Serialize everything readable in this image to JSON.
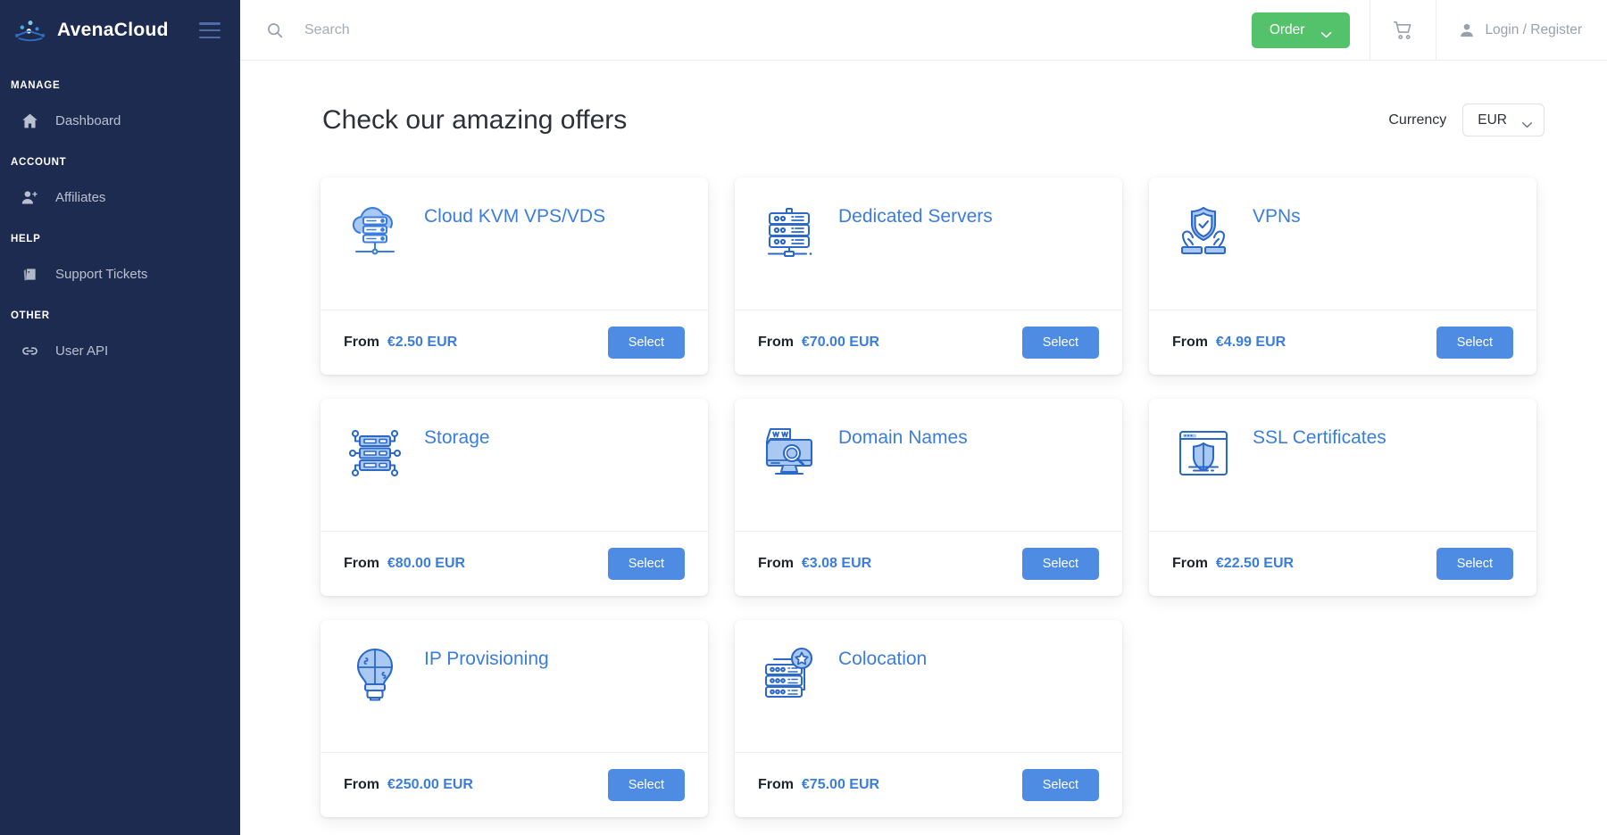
{
  "sidebar": {
    "brand": "AvenaCloud",
    "logo_icon": "avenacloud-logo-icon",
    "menu_toggle_icon": "hamburger-icon",
    "sections": [
      {
        "caption": "MANAGE",
        "items": [
          {
            "label": "Dashboard",
            "icon": "home-icon"
          }
        ]
      },
      {
        "caption": "ACCOUNT",
        "items": [
          {
            "label": "Affiliates",
            "icon": "user-add-icon"
          }
        ]
      },
      {
        "caption": "HELP",
        "items": [
          {
            "label": "Support Tickets",
            "icon": "tickets-icon"
          }
        ]
      },
      {
        "caption": "OTHER",
        "items": [
          {
            "label": "User API",
            "icon": "link-icon"
          }
        ]
      }
    ]
  },
  "topbar": {
    "search_icon": "search-icon",
    "search_value": "",
    "search_placeholder": "Search",
    "order_label": "Order",
    "order_chevron_icon": "chevron-down-icon",
    "cart_icon": "shopping-cart-icon",
    "account_icon": "person-icon",
    "account_label": "Login / Register"
  },
  "page": {
    "title": "Check our amazing offers",
    "currency_label": "Currency",
    "currency_value": "EUR",
    "currency_chevron_icon": "chevron-down-icon"
  },
  "colors": {
    "sidebar_bg": "#1e2b50",
    "accent_blue": "#3b7ddd",
    "select_button": "#4e8ce4",
    "order_button": "#53c26a",
    "title_text": "#2c3138",
    "muted_text": "#9aa0ac"
  },
  "products": [
    {
      "title": "Cloud KVM VPS/VDS",
      "icon": "cloud-server-icon",
      "price_prefix": "From",
      "price": "€2.50 EUR",
      "button": "Select"
    },
    {
      "title": "Dedicated Servers",
      "icon": "server-rack-icon",
      "price_prefix": "From",
      "price": "€70.00 EUR",
      "button": "Select"
    },
    {
      "title": "VPNs",
      "icon": "shield-hands-icon",
      "price_prefix": "From",
      "price": "€4.99 EUR",
      "button": "Select"
    },
    {
      "title": "Storage",
      "icon": "storage-nodes-icon",
      "price_prefix": "From",
      "price": "€80.00 EUR",
      "button": "Select"
    },
    {
      "title": "Domain Names",
      "icon": "domain-search-icon",
      "price_prefix": "From",
      "price": "€3.08 EUR",
      "button": "Select"
    },
    {
      "title": "SSL Certificates",
      "icon": "browser-shield-icon",
      "price_prefix": "From",
      "price": "€22.50 EUR",
      "button": "Select"
    },
    {
      "title": "IP Provisioning",
      "icon": "lightbulb-puzzle-icon",
      "price_prefix": "From",
      "price": "€250.00 EUR",
      "button": "Select"
    },
    {
      "title": "Colocation",
      "icon": "server-star-icon",
      "price_prefix": "From",
      "price": "€75.00 EUR",
      "button": "Select"
    }
  ]
}
